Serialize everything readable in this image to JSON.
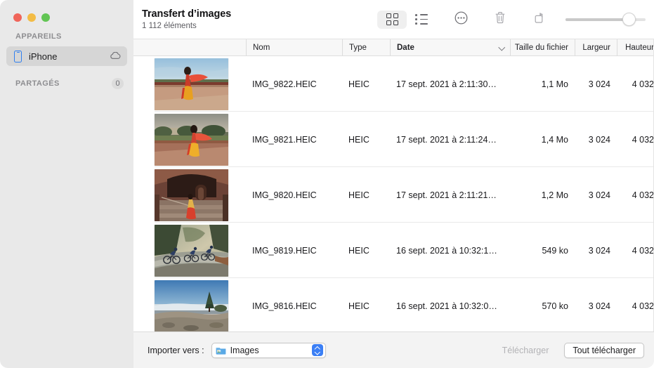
{
  "window": {
    "traffic_lights": [
      "close",
      "minimize",
      "maximize"
    ],
    "colors": {
      "close": "#f0655a",
      "minimize": "#f3bc45",
      "maximize": "#62c554",
      "accent_blue": "#3b7ff5",
      "sidebar_bg": "#e9e9e9",
      "selection_bg": "#d6d6d6",
      "bottom_bar_bg": "#f3f3f3"
    }
  },
  "sidebar": {
    "sections": [
      {
        "title": "APPAREILS",
        "badge": null
      },
      {
        "title": "PARTAGÉS",
        "badge": "0"
      }
    ],
    "devices": [
      {
        "label": "iPhone",
        "icon": "iphone-icon",
        "eject_icon": "cloud-icon",
        "selected": true
      }
    ]
  },
  "header": {
    "title": "Transfert d’images",
    "subtitle": "1 112 éléments"
  },
  "toolbar": {
    "buttons": [
      {
        "name": "grid-view-button",
        "icon": "grid-icon",
        "selected": true
      },
      {
        "name": "list-view-button",
        "icon": "list-icon",
        "selected": false
      },
      {
        "name": "more-options-button",
        "icon": "ellipsis-circle-icon",
        "selected": false
      },
      {
        "name": "delete-button",
        "icon": "trash-icon",
        "selected": false
      },
      {
        "name": "rotate-button",
        "icon": "rotate-icon",
        "selected": false
      }
    ],
    "zoom_slider": {
      "name": "thumbnail-size-slider",
      "value": 85,
      "min": 0,
      "max": 100
    }
  },
  "table": {
    "columns": [
      {
        "key": "thumbnail",
        "label": "",
        "align": "left",
        "sorted": false
      },
      {
        "key": "name",
        "label": "Nom",
        "align": "left",
        "sorted": false
      },
      {
        "key": "type",
        "label": "Type",
        "align": "left",
        "sorted": false
      },
      {
        "key": "date",
        "label": "Date",
        "align": "left",
        "sorted": true,
        "sort_direction": "descending"
      },
      {
        "key": "size",
        "label": "Taille du fichier",
        "align": "right",
        "sorted": false
      },
      {
        "key": "width",
        "label": "Largeur",
        "align": "right",
        "sorted": false
      },
      {
        "key": "height",
        "label": "Hauteur",
        "align": "right",
        "sorted": false
      }
    ],
    "rows": [
      {
        "name": "IMG_9822.HEIC",
        "type": "HEIC",
        "date": "17 sept. 2021 à 2:11:30…",
        "size": "1,1 Mo",
        "width": "3 024",
        "height": "4 032",
        "thumbnail": "woman-in-red-sari-at-monument"
      },
      {
        "name": "IMG_9821.HEIC",
        "type": "HEIC",
        "date": "17 sept. 2021 à 2:11:24…",
        "size": "1,4 Mo",
        "width": "3 024",
        "height": "4 032",
        "thumbnail": "woman-in-sari-overlooking-park"
      },
      {
        "name": "IMG_9820.HEIC",
        "type": "HEIC",
        "date": "17 sept. 2021 à 2:11:21…",
        "size": "1,2 Mo",
        "width": "3 024",
        "height": "4 032",
        "thumbnail": "woman-on-stone-staircase"
      },
      {
        "name": "IMG_9819.HEIC",
        "type": "HEIC",
        "date": "16 sept. 2021 à 10:32:1…",
        "size": "549 ko",
        "width": "3 024",
        "height": "4 032",
        "thumbnail": "cyclists-on-misty-road"
      },
      {
        "name": "IMG_9816.HEIC",
        "type": "HEIC",
        "date": "16 sept. 2021 à 10:32:0…",
        "size": "570 ko",
        "width": "3 024",
        "height": "4 032",
        "thumbnail": "tree-above-clouds-at-summit"
      }
    ]
  },
  "bottom_bar": {
    "import_label": "Importer vers :",
    "destination": {
      "value": "Images",
      "icon": "pictures-folder-icon"
    },
    "download_button": {
      "label": "Télécharger",
      "enabled": false
    },
    "download_all_button": {
      "label": "Tout télécharger",
      "enabled": true
    }
  }
}
